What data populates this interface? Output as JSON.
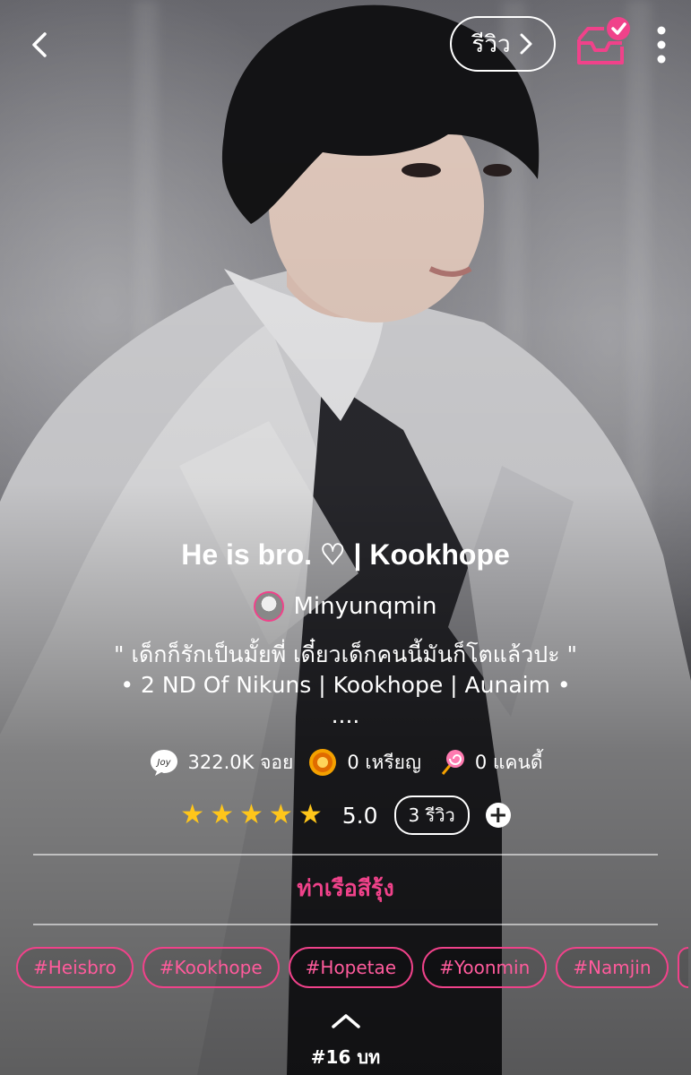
{
  "header": {
    "review_label": "รีวิว"
  },
  "story": {
    "title": "He is bro. ♡ | Kookhope",
    "author": "Minyunqmin",
    "description": "\" เด็กก็รักเป็นมั้ยพี่ เดี๋ยวเด็กคนนี้มันก็โตแล้วปะ \"\n• 2 ND Of Nikuns | Kookhope | Aunaim •\n....",
    "category": "ท่าเรือสีรุ้ง"
  },
  "stats": {
    "joy": "322.0K จอย",
    "coins": "0 เหรียญ",
    "candy": "0 แคนดี้"
  },
  "rating": {
    "stars": 5,
    "value": "5.0",
    "reviews": "3 รีวิว"
  },
  "tags": [
    "#Heisbro",
    "#Kookhope",
    "#Hopetae",
    "#Yoonmin",
    "#Namjin"
  ],
  "chapter": {
    "label": "#16 บท"
  },
  "colors": {
    "accent": "#f0428a",
    "star": "#ffc61a",
    "text": "#ffffff"
  },
  "icons": {
    "back": "chevron-left-icon",
    "review_arrow": "chevron-right-icon",
    "inbox": "inbox-check-icon",
    "more": "vertical-dots-icon",
    "joy": "joy-bubble-icon",
    "coin": "coin-icon",
    "candy": "lollipop-icon",
    "add": "plus-circle-icon",
    "up": "chevron-up-icon"
  }
}
